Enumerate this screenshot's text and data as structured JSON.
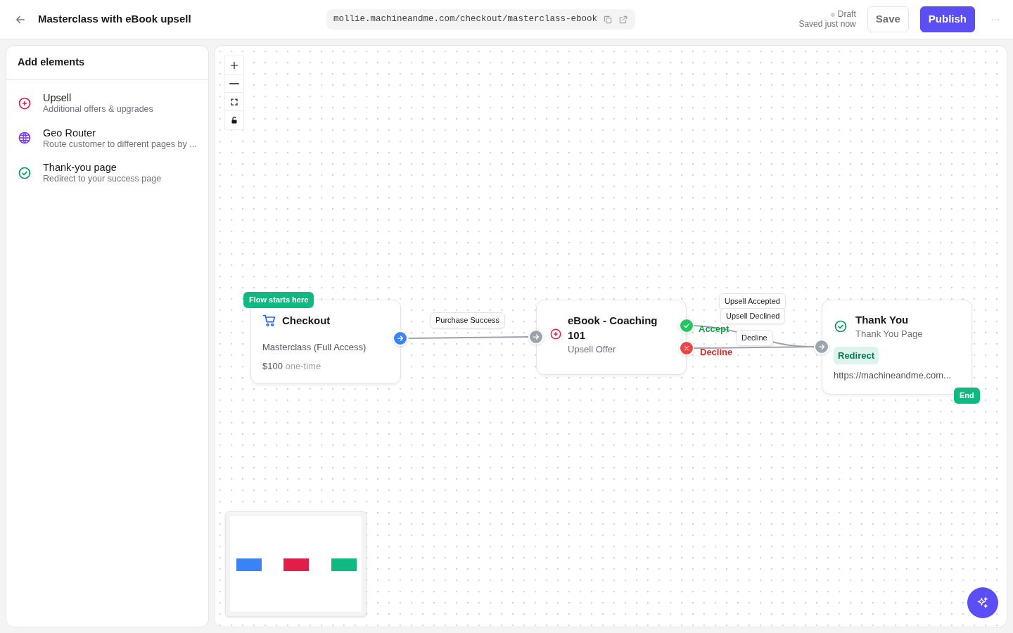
{
  "header": {
    "title": "Masterclass with eBook upsell",
    "url": "mollie.machineandme.com/checkout/masterclass-ebook",
    "status": "Draft",
    "saved": "Saved just now",
    "buttons": [
      {
        "label": "Save",
        "kind": "secondary"
      },
      {
        "label": "Publish",
        "kind": "primary"
      }
    ]
  },
  "sidebar": {
    "title": "Add elements",
    "items": [
      {
        "kind": "upsell",
        "title": "Upsell",
        "description": "Additional offers & upgrades"
      },
      {
        "kind": "geo",
        "title": "Geo Router",
        "description": "Route customer to different pages by ..."
      },
      {
        "kind": "thank_you",
        "title": "Thank-you page",
        "description": "Redirect to your success page"
      }
    ]
  },
  "canvas": {
    "nodes": [
      {
        "kind": "checkout",
        "badge": "Flow starts here",
        "title": "Checkout",
        "subtitle": "Masterclass (Full Access)",
        "price": "$100",
        "price_note": "one-time"
      },
      {
        "kind": "upsell",
        "title": "eBook - Coaching 101",
        "subtitle": "Upsell Offer"
      },
      {
        "kind": "thank_you",
        "title": "Thank You",
        "subtitle": "Thank You Page",
        "tag": "Redirect",
        "url": "https://machineandme.com...",
        "end_badge": "End"
      }
    ],
    "edge_labels": [
      "Purchase Success",
      "Upsell Accepted",
      "Upsell Declined",
      "Decline"
    ],
    "branch_labels": [
      {
        "kind": "accept",
        "text": "Accept"
      },
      {
        "kind": "decline",
        "text": "Decline"
      }
    ],
    "minimap": [
      {
        "color": "#3b82f6"
      },
      {
        "color": "#e11d48"
      },
      {
        "color": "#10b981"
      }
    ]
  }
}
